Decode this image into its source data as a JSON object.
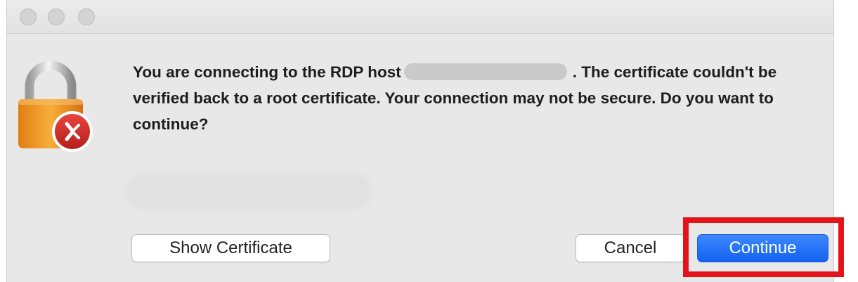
{
  "dialog": {
    "message_part1": "You are connecting to the RDP host",
    "message_part2": ". The certificate couldn't be verified back to a root certificate. Your connection may not be secure. Do you want to continue?"
  },
  "buttons": {
    "show_certificate": "Show Certificate",
    "cancel": "Cancel",
    "continue": "Continue"
  },
  "colors": {
    "window_bg": "#e8e8e8",
    "primary_button": "#1462f0",
    "highlight": "#e4131a",
    "lock_body": "#f29a26",
    "rdp_badge": "#d4302b"
  },
  "icons": {
    "main": "lock-icon",
    "badge": "remote-desktop-icon"
  }
}
